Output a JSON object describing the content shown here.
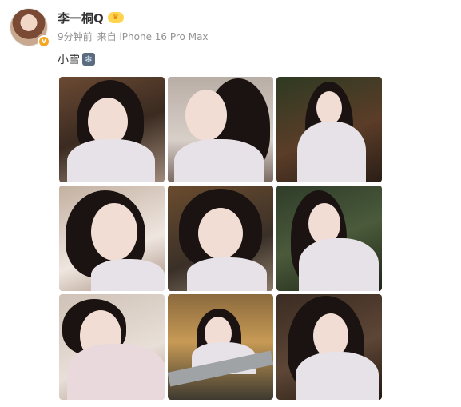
{
  "post": {
    "username": "李一桐Q",
    "time": "9分钟前",
    "source": "来自 iPhone 16 Pro Max",
    "text": "小雪"
  },
  "icons": {
    "vip": "crown-badge-icon",
    "verified": "verified-badge-icon",
    "snow": "snowflake-emoji-icon"
  },
  "photos": [
    {
      "label": "photo-1"
    },
    {
      "label": "photo-2"
    },
    {
      "label": "photo-3"
    },
    {
      "label": "photo-4"
    },
    {
      "label": "photo-5"
    },
    {
      "label": "photo-6"
    },
    {
      "label": "photo-7"
    },
    {
      "label": "photo-8"
    },
    {
      "label": "photo-9"
    }
  ],
  "colors": {
    "username": "#333333",
    "meta": "#939393",
    "verified": "#f5a623"
  }
}
